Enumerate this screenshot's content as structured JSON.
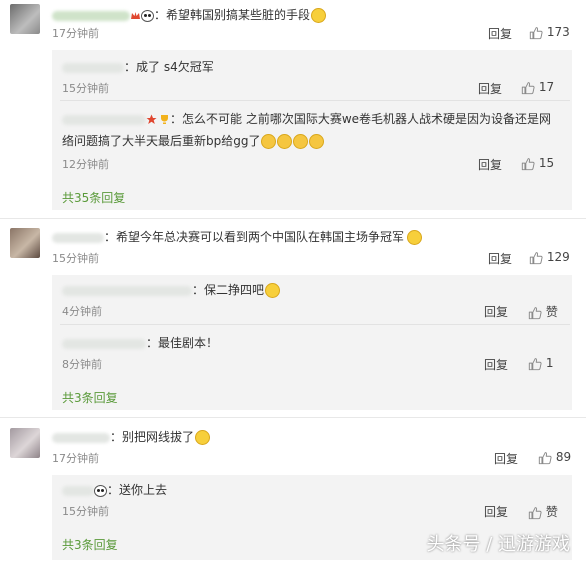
{
  "reply_label": "回复",
  "like_label": "赞",
  "comments": [
    {
      "text": "：希望韩国别搞某些脏的手段",
      "time": "17分钟前",
      "likes": "173",
      "replies": [
        {
          "text": "：成了 s4欠冠军",
          "time": "15分钟前",
          "likes": "17"
        },
        {
          "text": "：怎么不可能 之前哪次国际大赛we卷毛机器人战术硬是因为设备还是网",
          "text_line2": "络问题搞了大半天最后重新bp给gg了",
          "time": "12分钟前",
          "likes": "15"
        }
      ],
      "more": "共35条回复"
    },
    {
      "text": "：希望今年总决赛可以看到两个中国队在韩国主场争冠军",
      "time": "15分钟前",
      "likes": "129",
      "replies": [
        {
          "text": "：保二挣四吧",
          "time": "4分钟前",
          "likes": "赞"
        },
        {
          "text": "：最佳剧本！",
          "time": "8分钟前",
          "likes": "1"
        }
      ],
      "more": "共3条回复"
    },
    {
      "text": "：别把网线拔了",
      "time": "17分钟前",
      "likes": "89",
      "replies": [
        {
          "text": "：送你上去",
          "time": "15分钟前",
          "likes": "赞"
        }
      ],
      "more": "共3条回复"
    }
  ],
  "watermark": "头条号 / 迅游游戏"
}
